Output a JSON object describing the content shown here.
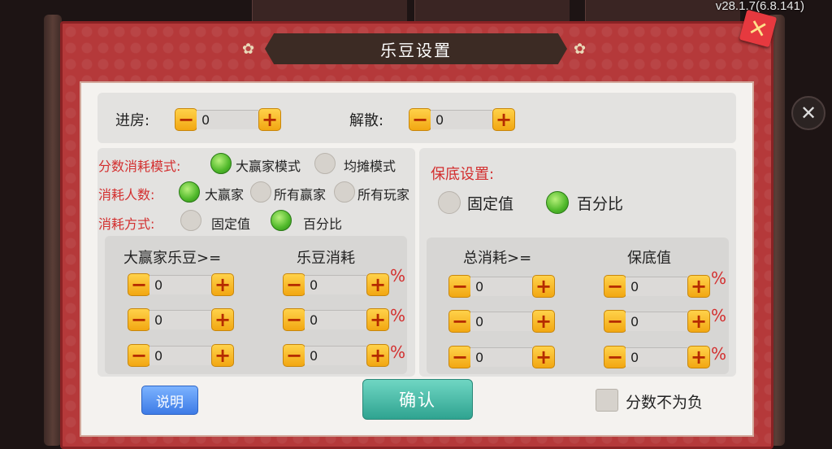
{
  "version": "v28.1.7(6.8.141)",
  "dialog": {
    "title": "乐豆设置"
  },
  "top": {
    "enter_label": "进房:",
    "enter_value": "0",
    "dismiss_label": "解散:",
    "dismiss_value": "0"
  },
  "left": {
    "score_mode_label": "分数消耗模式:",
    "score_mode_options": [
      "大赢家模式",
      "均摊模式"
    ],
    "score_mode_selected": "大赢家模式",
    "count_label": "消耗人数:",
    "count_options": [
      "大赢家",
      "所有赢家",
      "所有玩家"
    ],
    "count_selected": "大赢家",
    "method_label": "消耗方式:",
    "method_options": [
      "固定值",
      "百分比"
    ],
    "method_selected": "百分比",
    "col1_header": "大赢家乐豆>=",
    "col2_header": "乐豆消耗",
    "rows": [
      {
        "threshold": "0",
        "cost": "0",
        "unit": "%"
      },
      {
        "threshold": "0",
        "cost": "0",
        "unit": "%"
      },
      {
        "threshold": "0",
        "cost": "0",
        "unit": "%"
      }
    ]
  },
  "right": {
    "guarantee_label": "保底设置:",
    "guarantee_options": [
      "固定值",
      "百分比"
    ],
    "guarantee_selected": "百分比",
    "col1_header": "总消耗>=",
    "col2_header": "保底值",
    "rows": [
      {
        "total": "0",
        "floor": "0",
        "unit": "%"
      },
      {
        "total": "0",
        "floor": "0",
        "unit": "%"
      },
      {
        "total": "0",
        "floor": "0",
        "unit": "%"
      }
    ]
  },
  "footer": {
    "help_label": "说明",
    "confirm_label": "确认",
    "nonneg_label": "分数不为负",
    "nonneg_checked": false
  },
  "stepper_symbols": {
    "minus": "−",
    "plus": "+"
  },
  "colors": {
    "frame": "#b5393a",
    "accent_red": "#d32f2f",
    "radio_on": "#4fb82a",
    "confirm": "#2fa390",
    "help": "#3d7be6"
  }
}
